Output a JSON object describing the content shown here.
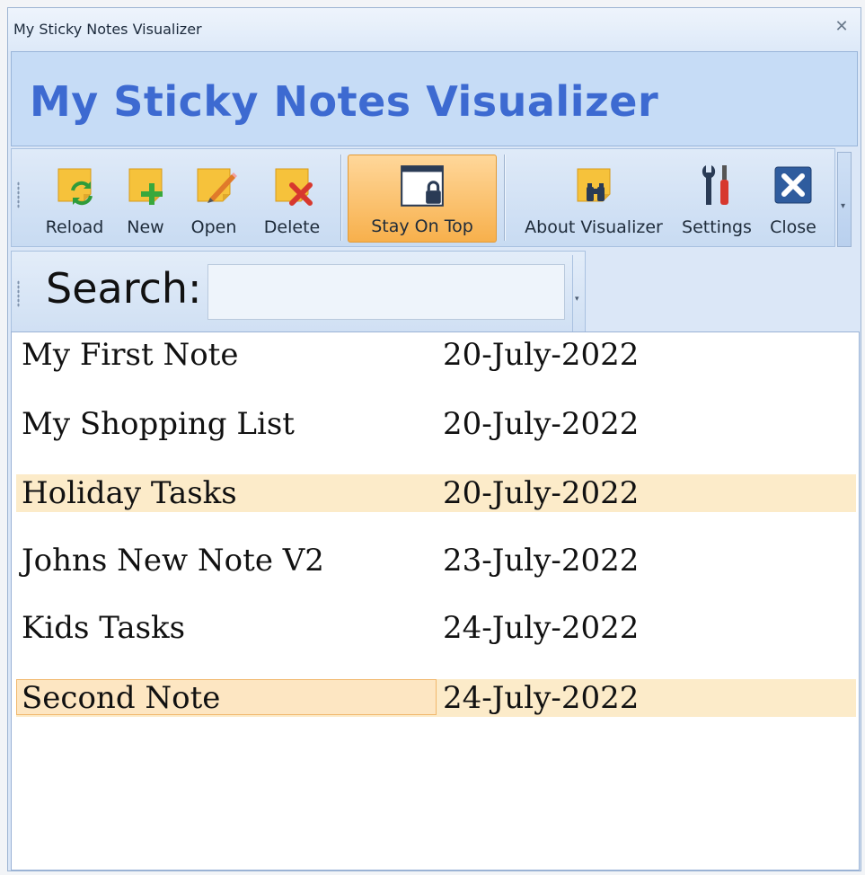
{
  "window": {
    "title": "My Sticky Notes Visualizer"
  },
  "banner": {
    "title": "My Sticky Notes Visualizer"
  },
  "toolbar": {
    "reload": "Reload",
    "new": "New",
    "open": "Open",
    "delete": "Delete",
    "stay_on_top": "Stay On Top",
    "about": "About Visualizer",
    "settings": "Settings",
    "close": "Close"
  },
  "search": {
    "label": "Search:",
    "value": ""
  },
  "notes": [
    {
      "name": "My First Note",
      "date": "20-July-2022"
    },
    {
      "name": "My Shopping List",
      "date": "20-July-2022"
    },
    {
      "name": "Holiday Tasks",
      "date": "20-July-2022"
    },
    {
      "name": "Johns New Note V2",
      "date": "23-July-2022"
    },
    {
      "name": "Kids Tasks",
      "date": "24-July-2022"
    },
    {
      "name": "Second Note",
      "date": "24-July-2022"
    }
  ],
  "colors": {
    "accent": "#3d6ad1",
    "row_highlight": "#fcebc9",
    "active_button": "#f7b04c"
  },
  "icons": [
    "close-icon",
    "reload-icon",
    "new-note-icon",
    "open-note-icon",
    "delete-note-icon",
    "stay-on-top-icon",
    "about-icon",
    "settings-icon",
    "close-app-icon"
  ]
}
